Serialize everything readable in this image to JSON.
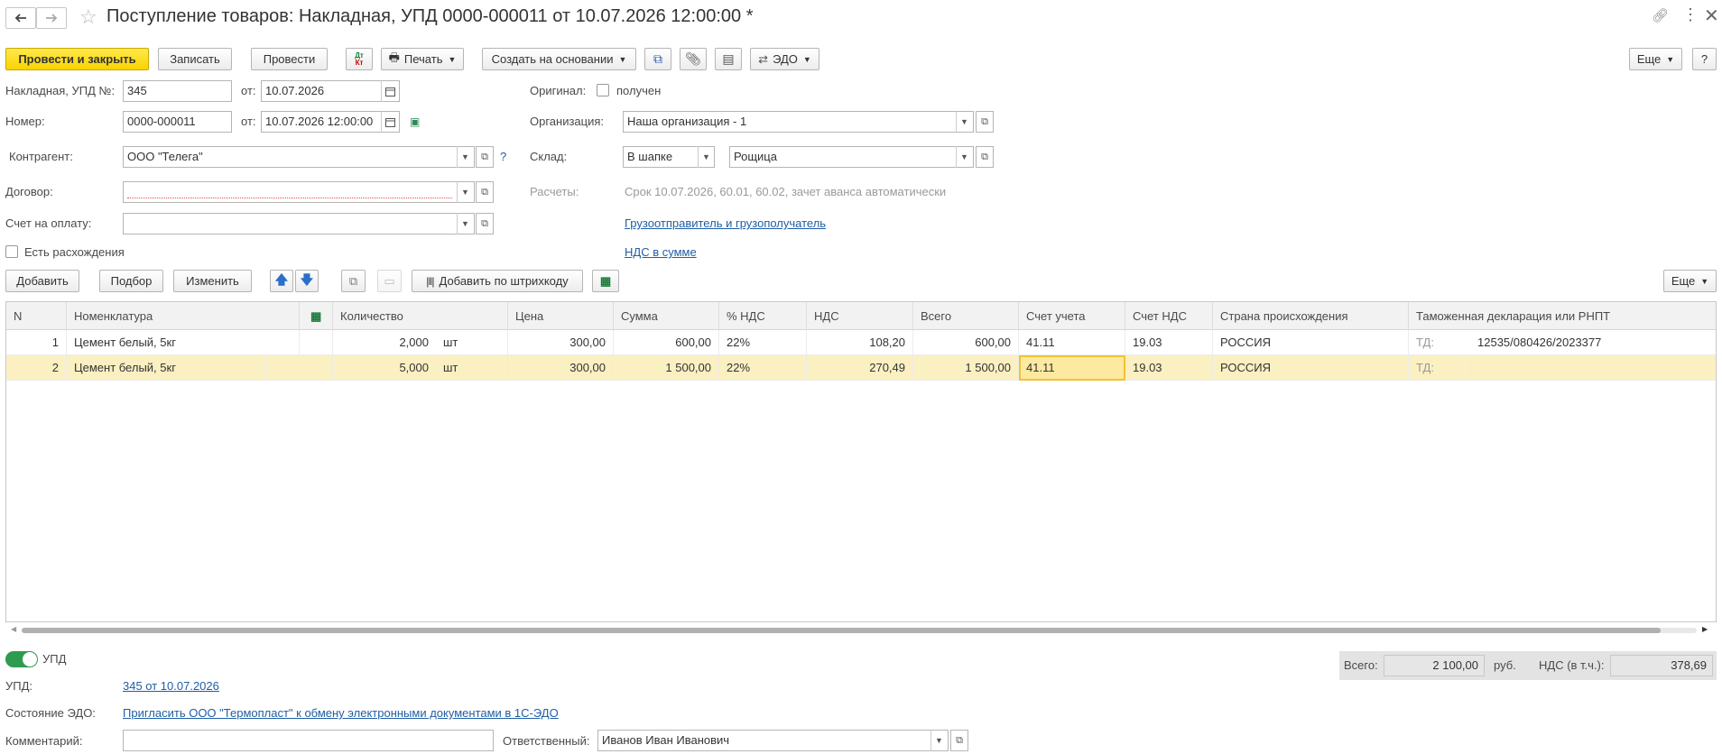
{
  "header": {
    "title": "Поступление товаров: Накладная, УПД 0000-000011 от 10.07.2026 12:00:00 *"
  },
  "toolbar": {
    "post_close": "Провести и закрыть",
    "save": "Записать",
    "post": "Провести",
    "print": "Печать",
    "create_based": "Создать на основании",
    "edo": "ЭДО",
    "more": "Еще",
    "help": "?"
  },
  "form": {
    "invoice_label": "Накладная, УПД №:",
    "invoice_value": "345",
    "from_label": "от:",
    "invoice_date": "10.07.2026",
    "number_label": "Номер:",
    "number_value": "0000-000011",
    "number_date": "10.07.2026 12:00:00",
    "counterparty_label": "Контрагент:",
    "counterparty_value": "ООО \"Телега\"",
    "contract_label": "Договор:",
    "contract_value": "",
    "invoice_pay_label": "Счет на оплату:",
    "invoice_pay_value": "",
    "discrepancy_label": "Есть расхождения",
    "original_label": "Оригинал:",
    "original_check_label": "получен",
    "org_label": "Организация:",
    "org_value": "Наша организация - 1",
    "warehouse_label": "Склад:",
    "warehouse_mode": "В шапке",
    "warehouse_value": "Рощица",
    "settlements_label": "Расчеты:",
    "settlements_value": "Срок 10.07.2026, 60.01, 60.02, зачет аванса автоматически",
    "shipper_link": "Грузоотправитель и грузополучатель",
    "vat_link": "НДС в сумме",
    "help_q": "?"
  },
  "table_toolbar": {
    "add": "Добавить",
    "pick": "Подбор",
    "edit": "Изменить",
    "barcode": "Добавить по штрихкоду",
    "more": "Еще"
  },
  "table": {
    "columns": [
      "N",
      "Номенклатура",
      "Количество",
      "Цена",
      "Сумма",
      "% НДС",
      "НДС",
      "Всего",
      "Счет учета",
      "Счет НДС",
      "Страна происхождения",
      "Таможенная декларация или РНПТ"
    ],
    "rows": [
      {
        "n": "1",
        "name": "Цемент белый, 5кг",
        "qty": "2,000",
        "unit": "шт",
        "price": "300,00",
        "sum": "600,00",
        "vat_rate": "22%",
        "vat": "108,20",
        "total": "600,00",
        "account": "41.11",
        "vat_account": "19.03",
        "country": "РОССИЯ",
        "td_label": "ТД:",
        "td": "12535/080426/2023377"
      },
      {
        "n": "2",
        "name": "Цемент белый, 5кг",
        "qty": "5,000",
        "unit": "шт",
        "price": "300,00",
        "sum": "1 500,00",
        "vat_rate": "22%",
        "vat": "270,49",
        "total": "1 500,00",
        "account": "41.11",
        "vat_account": "19.03",
        "country": "РОССИЯ",
        "td_label": "ТД:",
        "td": ""
      }
    ]
  },
  "footer": {
    "upd_toggle_label": "УПД",
    "upd_label": "УПД:",
    "upd_link": "345 от 10.07.2026",
    "edo_state_label": "Состояние ЭДО:",
    "edo_state_link": "Пригласить ООО \"Термопласт\" к обмену электронными документами в 1С-ЭДО",
    "comment_label": "Комментарий:",
    "comment_value": "",
    "responsible_label": "Ответственный:",
    "responsible_value": "Иванов Иван Иванович",
    "total_label": "Всего:",
    "total_value": "2 100,00",
    "currency": "руб.",
    "vat_label": "НДС (в т.ч.):",
    "vat_value": "378,69"
  },
  "colors": {
    "primary_button": "#f8d400",
    "link": "#1f5ea5",
    "selected_row": "#fbf0c1",
    "toggle_on": "#2e9b4f"
  }
}
